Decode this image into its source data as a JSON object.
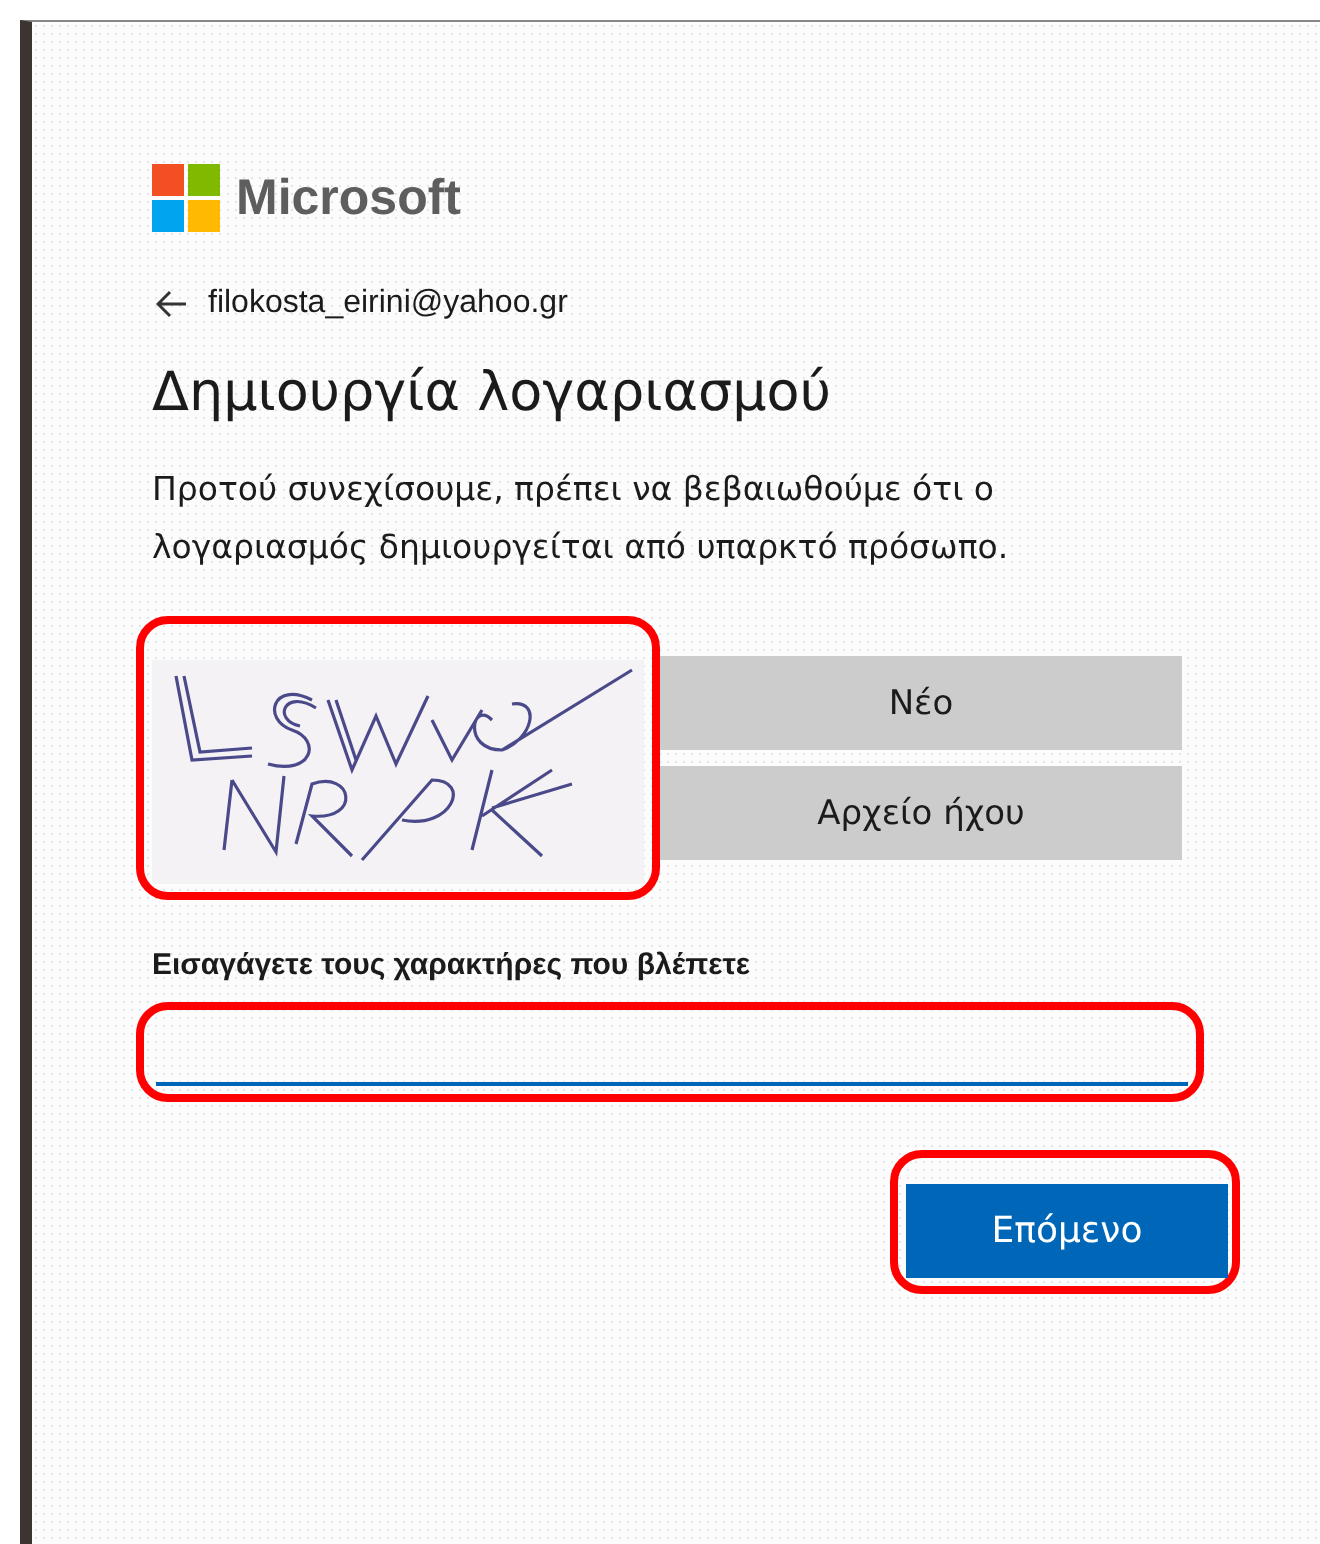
{
  "brand": {
    "name": "Microsoft"
  },
  "account": {
    "email": "filokosta_eirini@yahoo.gr"
  },
  "title": "Δημιουργία λογαριασμού",
  "description": "Προτού συνεχίσουμε, πρέπει να βεβαιωθούμε ότι ο λογαριασμός δημιουργείται από υπαρκτό πρόσωπο.",
  "captcha": {
    "highlighted": true,
    "buttons": [
      "Νέο",
      "Αρχείο ήχου"
    ]
  },
  "input": {
    "label": "Εισαγάγετε τους χαρακτήρες που βλέπετε",
    "highlighted": true
  },
  "next_button": {
    "label": "Επόμενο",
    "highlighted": true
  }
}
